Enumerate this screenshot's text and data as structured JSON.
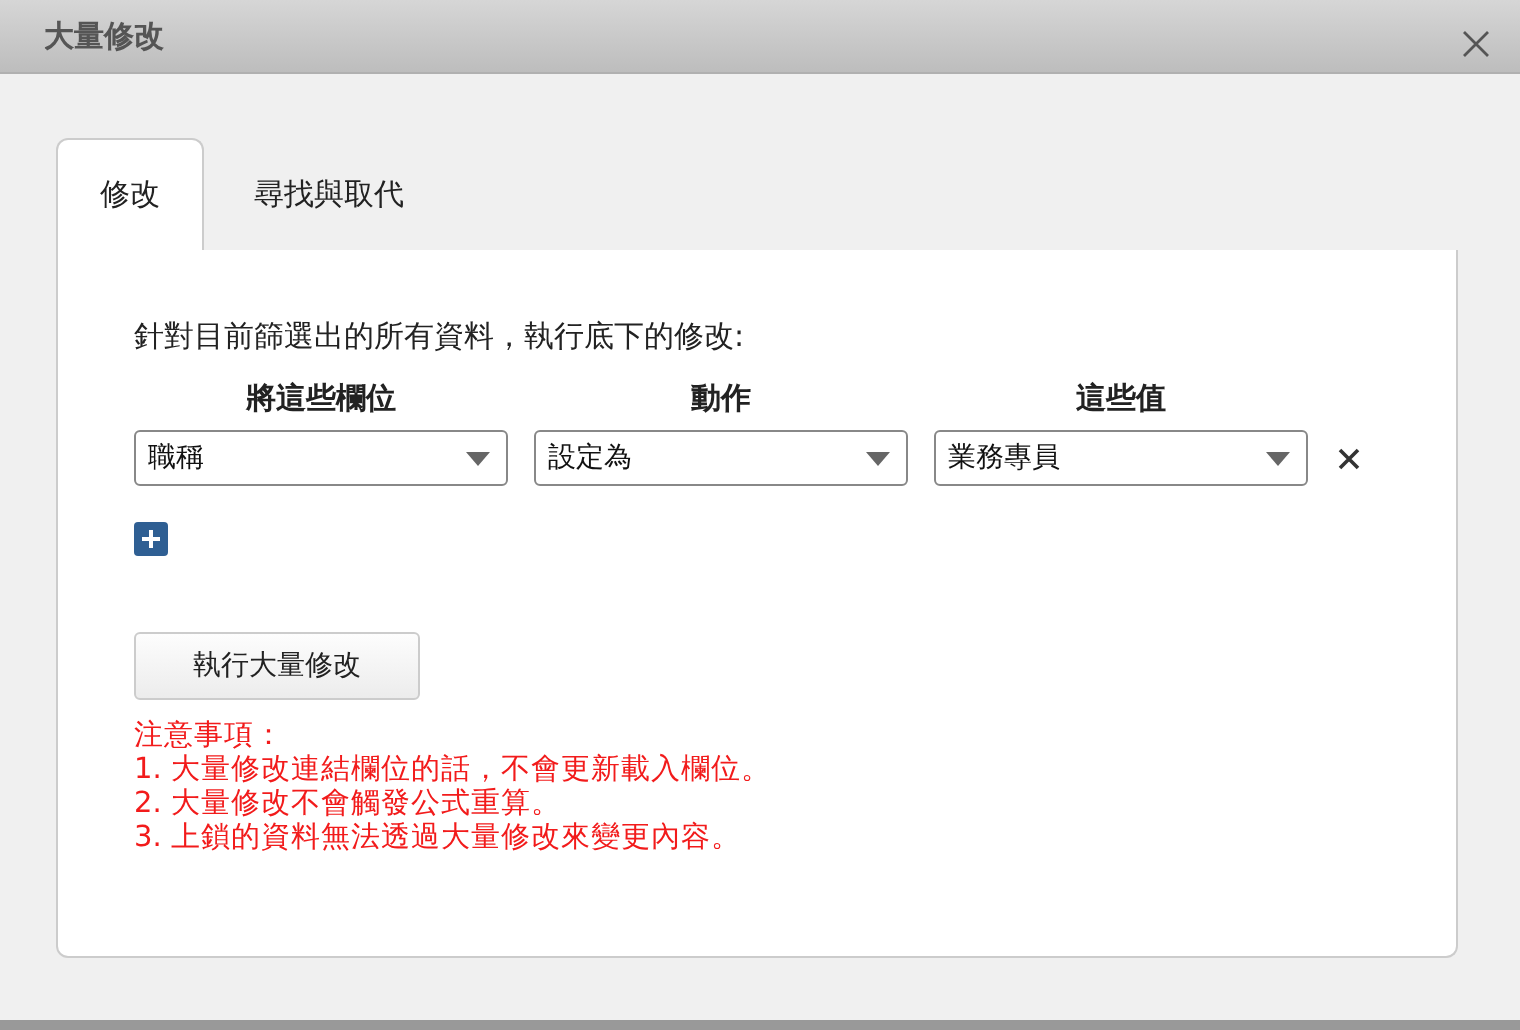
{
  "window": {
    "title": "大量修改"
  },
  "tabs": [
    {
      "label": "修改",
      "selected": true
    },
    {
      "label": "尋找與取代",
      "selected": false
    }
  ],
  "intro": "針對目前篩選出的所有資料，執行底下的修改:",
  "columns": [
    "將這些欄位",
    "動作",
    "這些值"
  ],
  "rules": [
    {
      "values": [
        "職稱",
        "設定為",
        "業務專員"
      ]
    }
  ],
  "run_button": "執行大量修改",
  "notes": {
    "title": "注意事項：",
    "lines": [
      "1. 大量修改連結欄位的話，不會更新載入欄位。",
      "2. 大量修改不會觸發公式重算。",
      "3. 上鎖的資料無法透過大量修改來變更內容。"
    ]
  }
}
